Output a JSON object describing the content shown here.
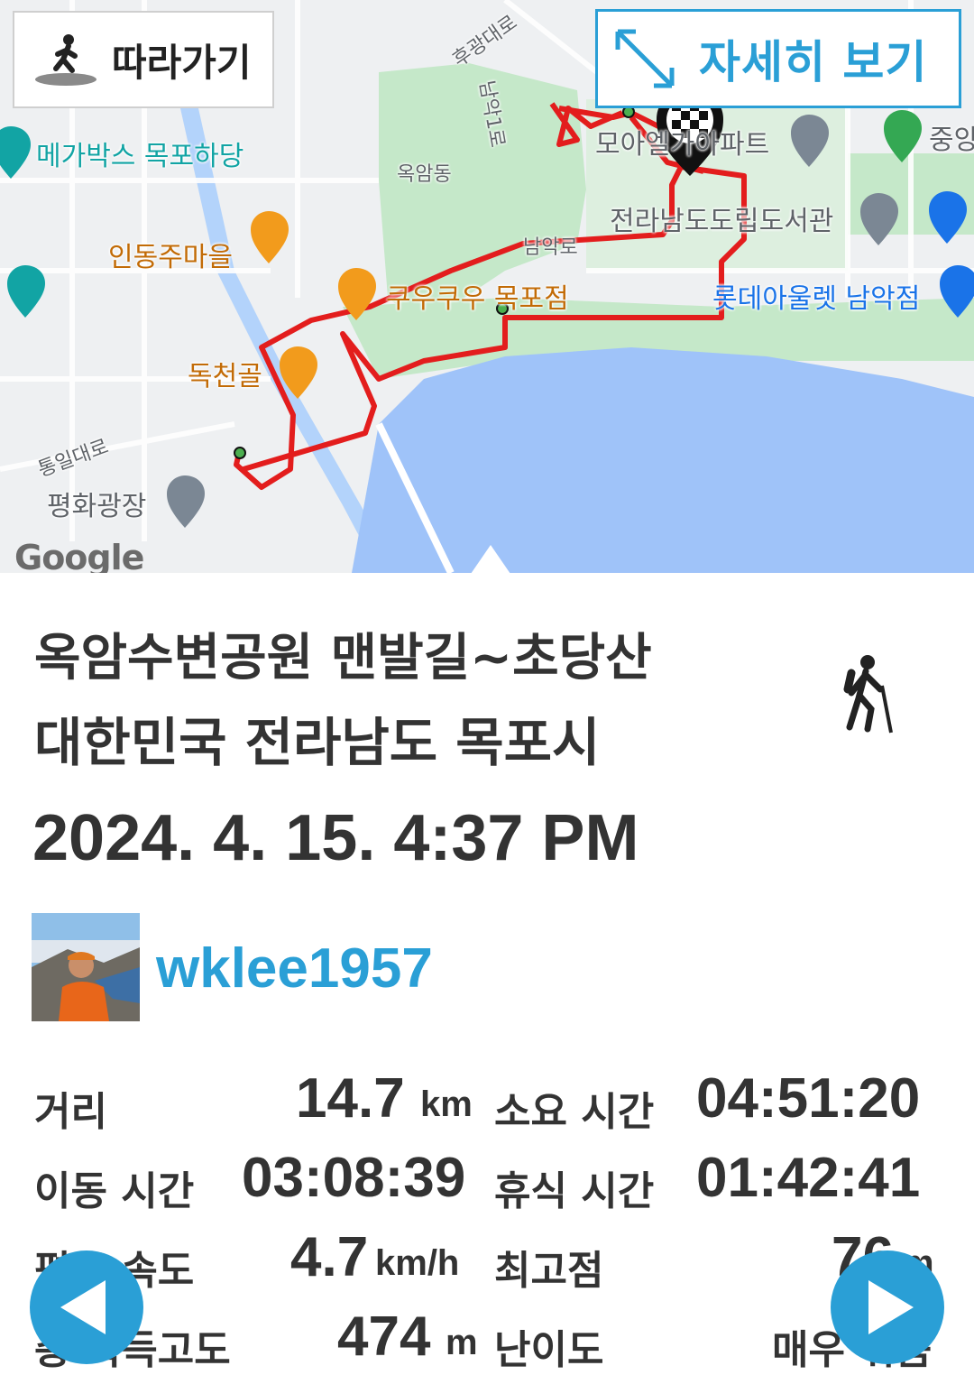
{
  "map": {
    "follow_label": "따라가기",
    "detail_label": "자세히 보기",
    "attribution": "Google",
    "labels": {
      "megabox": "메가박스 목포하당",
      "okam": "옥암동",
      "indong": "인동주마을",
      "kuukuu": "쿠우쿠우 목포점",
      "dokcheon": "독천골",
      "peace": "평화광장",
      "moa": "모아엘가아파트",
      "library": "전라남도도립도서관",
      "lotte": "롯데아울렛 남악점",
      "namak": "남악로",
      "hugwang": "후광대로",
      "tongil": "통일대로",
      "jungang": "중앙",
      "namak2": "남악1로"
    },
    "colors": {
      "route": "#e31d1d",
      "water": "#9fc3f9",
      "park": "#c5e8c9",
      "land": "#eef0f2"
    }
  },
  "trip": {
    "title": "옥암수변공원 맨발길~초당산",
    "region": "대한민국 전라남도 목포시",
    "date": "2024. 4. 15. 4:37 PM",
    "activity_icon": "hiking-icon"
  },
  "user": {
    "name": "wklee1957"
  },
  "stats": {
    "distance_label": "거리",
    "distance_value": "14.7",
    "distance_unit": "km",
    "duration_label": "소요 시간",
    "duration_value": "04:51:20",
    "moving_label": "이동 시간",
    "moving_value": "03:08:39",
    "rest_label": "휴식 시간",
    "rest_value": "01:42:41",
    "speed_label": "평균 속도",
    "speed_value": "4.7",
    "speed_unit": "km/h",
    "max_alt_label": "최고점",
    "max_alt_value": "76",
    "max_alt_unit": "m",
    "climb_label": "총 획득고도",
    "climb_value": "474",
    "climb_unit": "m",
    "difficulty_label": "난이도",
    "difficulty_value": "매우 쉬움"
  }
}
